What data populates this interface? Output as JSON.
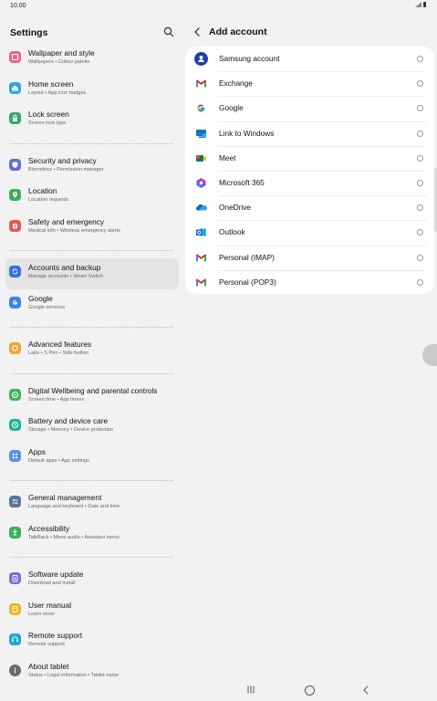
{
  "status": {
    "time": "10.00"
  },
  "left": {
    "title": "Settings",
    "items": [
      {
        "title": "Wallpaper and style",
        "sub": "Wallpapers  •  Colour palette",
        "icon": "wallpaper-icon",
        "color": "#e9638a"
      },
      {
        "title": "Home screen",
        "sub": "Layout  •  App icon badges",
        "icon": "home-icon",
        "color": "#2aa8e0"
      },
      {
        "title": "Lock screen",
        "sub": "Screen lock type",
        "icon": "lock-icon",
        "color": "#2faa6a"
      },
      {
        "title": "Security and privacy",
        "sub": "Biometrics  •  Permission manager",
        "icon": "shield-icon",
        "color": "#5b6fd6"
      },
      {
        "title": "Location",
        "sub": "Location requests",
        "icon": "location-icon",
        "color": "#3aae5b"
      },
      {
        "title": "Safety and emergency",
        "sub": "Medical info  •  Wireless emergency alerts",
        "icon": "emergency-icon",
        "color": "#e6584f"
      },
      {
        "title": "Accounts and backup",
        "sub": "Manage accounts  •  Smart Switch",
        "icon": "sync-icon",
        "color": "#3b6fe0"
      },
      {
        "title": "Google",
        "sub": "Google services",
        "icon": "google-icon",
        "color": "#3b82f0"
      },
      {
        "title": "Advanced features",
        "sub": "Labs  •  S Pen  •  Side button",
        "icon": "star-gear-icon",
        "color": "#f2a536"
      },
      {
        "title": "Digital Wellbeing and parental controls",
        "sub": "Screen time  •  App timers",
        "icon": "wellbeing-icon",
        "color": "#44b35a"
      },
      {
        "title": "Battery and device care",
        "sub": "Storage  •  Memory  •  Device protection",
        "icon": "battery-care-icon",
        "color": "#1fb39b"
      },
      {
        "title": "Apps",
        "sub": "Default apps  •  App settings",
        "icon": "apps-icon",
        "color": "#5b8fe6"
      },
      {
        "title": "General management",
        "sub": "Language and keyboard  •  Date and time",
        "icon": "sliders-icon",
        "color": "#5b7397"
      },
      {
        "title": "Accessibility",
        "sub": "TalkBack  •  Mono audio  •  Assistant menu",
        "icon": "accessibility-icon",
        "color": "#3aae5b"
      },
      {
        "title": "Software update",
        "sub": "Download and install",
        "icon": "update-icon",
        "color": "#7b6fd6"
      },
      {
        "title": "User manual",
        "sub": "Learn more",
        "icon": "manual-icon",
        "color": "#e8b820"
      },
      {
        "title": "Remote support",
        "sub": "Remote support",
        "icon": "headset-icon",
        "color": "#22a8c6"
      },
      {
        "title": "About tablet",
        "sub": "Status  •  Legal information  •  Tablet name",
        "icon": "info-icon",
        "color": "#6a6a6a"
      }
    ]
  },
  "right": {
    "title": "Add account",
    "accounts": [
      {
        "label": "Samsung account",
        "icon": "samsung-account-icon"
      },
      {
        "label": "Exchange",
        "icon": "gmail-icon"
      },
      {
        "label": "Google",
        "icon": "google-g-icon"
      },
      {
        "label": "Link to Windows",
        "icon": "link-to-windows-icon"
      },
      {
        "label": "Meet",
        "icon": "meet-icon"
      },
      {
        "label": "Microsoft 365",
        "icon": "microsoft-365-icon"
      },
      {
        "label": "OneDrive",
        "icon": "onedrive-icon"
      },
      {
        "label": "Outlook",
        "icon": "outlook-icon"
      },
      {
        "label": "Personal (IMAP)",
        "icon": "gmail-icon"
      },
      {
        "label": "Personal (POP3)",
        "icon": "gmail-icon"
      }
    ]
  }
}
